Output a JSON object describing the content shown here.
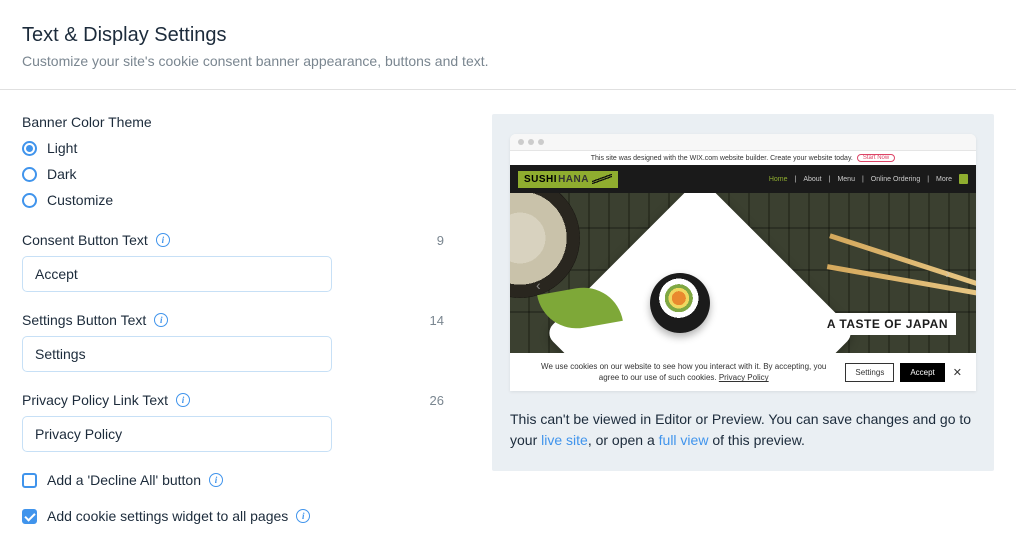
{
  "header": {
    "title": "Text & Display Settings",
    "subtitle": "Customize your site's cookie consent banner appearance, buttons and text."
  },
  "theme": {
    "label": "Banner Color Theme",
    "options": {
      "light": "Light",
      "dark": "Dark",
      "customize": "Customize"
    },
    "selected": "light"
  },
  "fields": {
    "consent": {
      "label": "Consent Button Text",
      "value": "Accept",
      "count": "9"
    },
    "settings": {
      "label": "Settings Button Text",
      "value": "Settings",
      "count": "14"
    },
    "privacy": {
      "label": "Privacy Policy Link Text",
      "value": "Privacy Policy",
      "count": "26"
    }
  },
  "checks": {
    "decline": {
      "label": "Add a 'Decline All' button",
      "checked": false
    },
    "widget": {
      "label": "Add cookie settings widget to all pages",
      "checked": true
    }
  },
  "preview": {
    "topbar": "This site was designed with the WIX.com website builder. Create your website today.",
    "topbar_btn": "Start Now",
    "logo_a": "SUSHI",
    "logo_b": "HANA",
    "nav": {
      "home": "Home",
      "about": "About",
      "menu": "Menu",
      "order": "Online Ordering",
      "more": "More"
    },
    "hero_tag": "A TASTE OF JAPAN",
    "cookie_text_a": "We use cookies on our website to see how you interact with it. By accepting, you agree to our use of such cookies. ",
    "cookie_pp": "Privacy Policy",
    "settings_btn": "Settings",
    "accept_btn": "Accept",
    "note_a": "This can't be viewed in Editor or Preview. You can save changes and go to your ",
    "note_live": "live site",
    "note_b": ", or open a ",
    "note_full": "full view",
    "note_c": " of this preview."
  }
}
